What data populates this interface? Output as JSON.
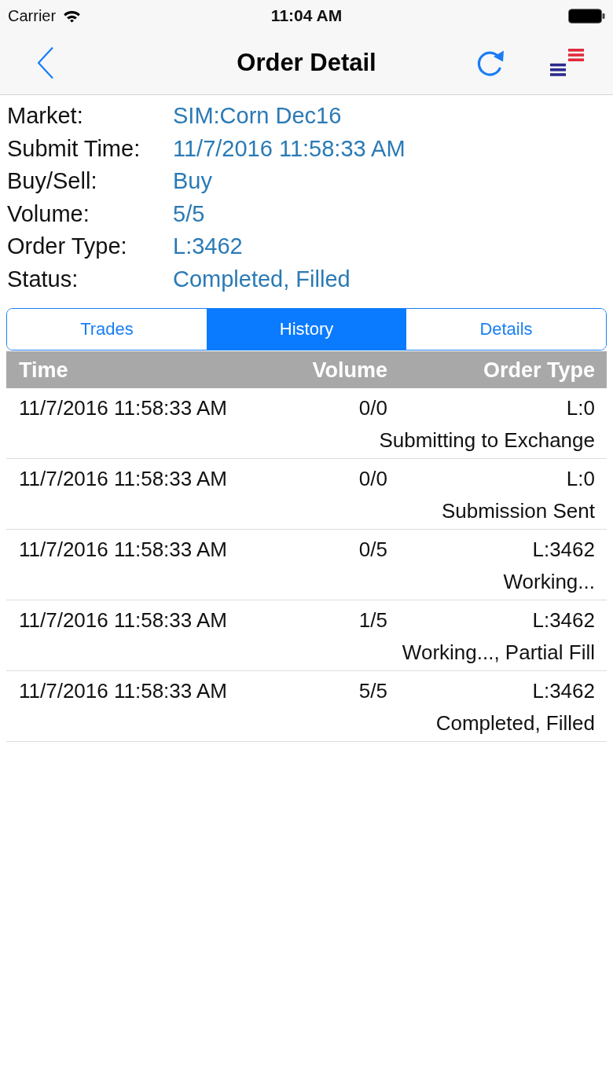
{
  "status_bar": {
    "carrier": "Carrier",
    "time": "11:04 AM"
  },
  "nav_bar": {
    "title": "Order Detail"
  },
  "order_info": [
    {
      "label": "Market:",
      "value": "SIM:Corn Dec16"
    },
    {
      "label": "Submit Time:",
      "value": "11/7/2016 11:58:33 AM"
    },
    {
      "label": "Buy/Sell:",
      "value": "Buy"
    },
    {
      "label": "Volume:",
      "value": "5/5"
    },
    {
      "label": "Order Type:",
      "value": "L:3462"
    },
    {
      "label": "Status:",
      "value": "Completed, Filled"
    }
  ],
  "tabs": [
    {
      "label": "Trades",
      "selected": false
    },
    {
      "label": "History",
      "selected": true
    },
    {
      "label": "Details",
      "selected": false
    }
  ],
  "history_table": {
    "columns": [
      "Time",
      "Volume",
      "Order Type"
    ],
    "rows": [
      {
        "time": "11/7/2016 11:58:33 AM",
        "volume": "0/0",
        "order_type": "L:0",
        "status": "Submitting to Exchange"
      },
      {
        "time": "11/7/2016 11:58:33 AM",
        "volume": "0/0",
        "order_type": "L:0",
        "status": "Submission Sent"
      },
      {
        "time": "11/7/2016 11:58:33 AM",
        "volume": "0/5",
        "order_type": "L:3462",
        "status": "Working..."
      },
      {
        "time": "11/7/2016 11:58:33 AM",
        "volume": "1/5",
        "order_type": "L:3462",
        "status": "Working..., Partial Fill"
      },
      {
        "time": "11/7/2016 11:58:33 AM",
        "volume": "5/5",
        "order_type": "L:3462",
        "status": "Completed, Filled"
      }
    ]
  }
}
